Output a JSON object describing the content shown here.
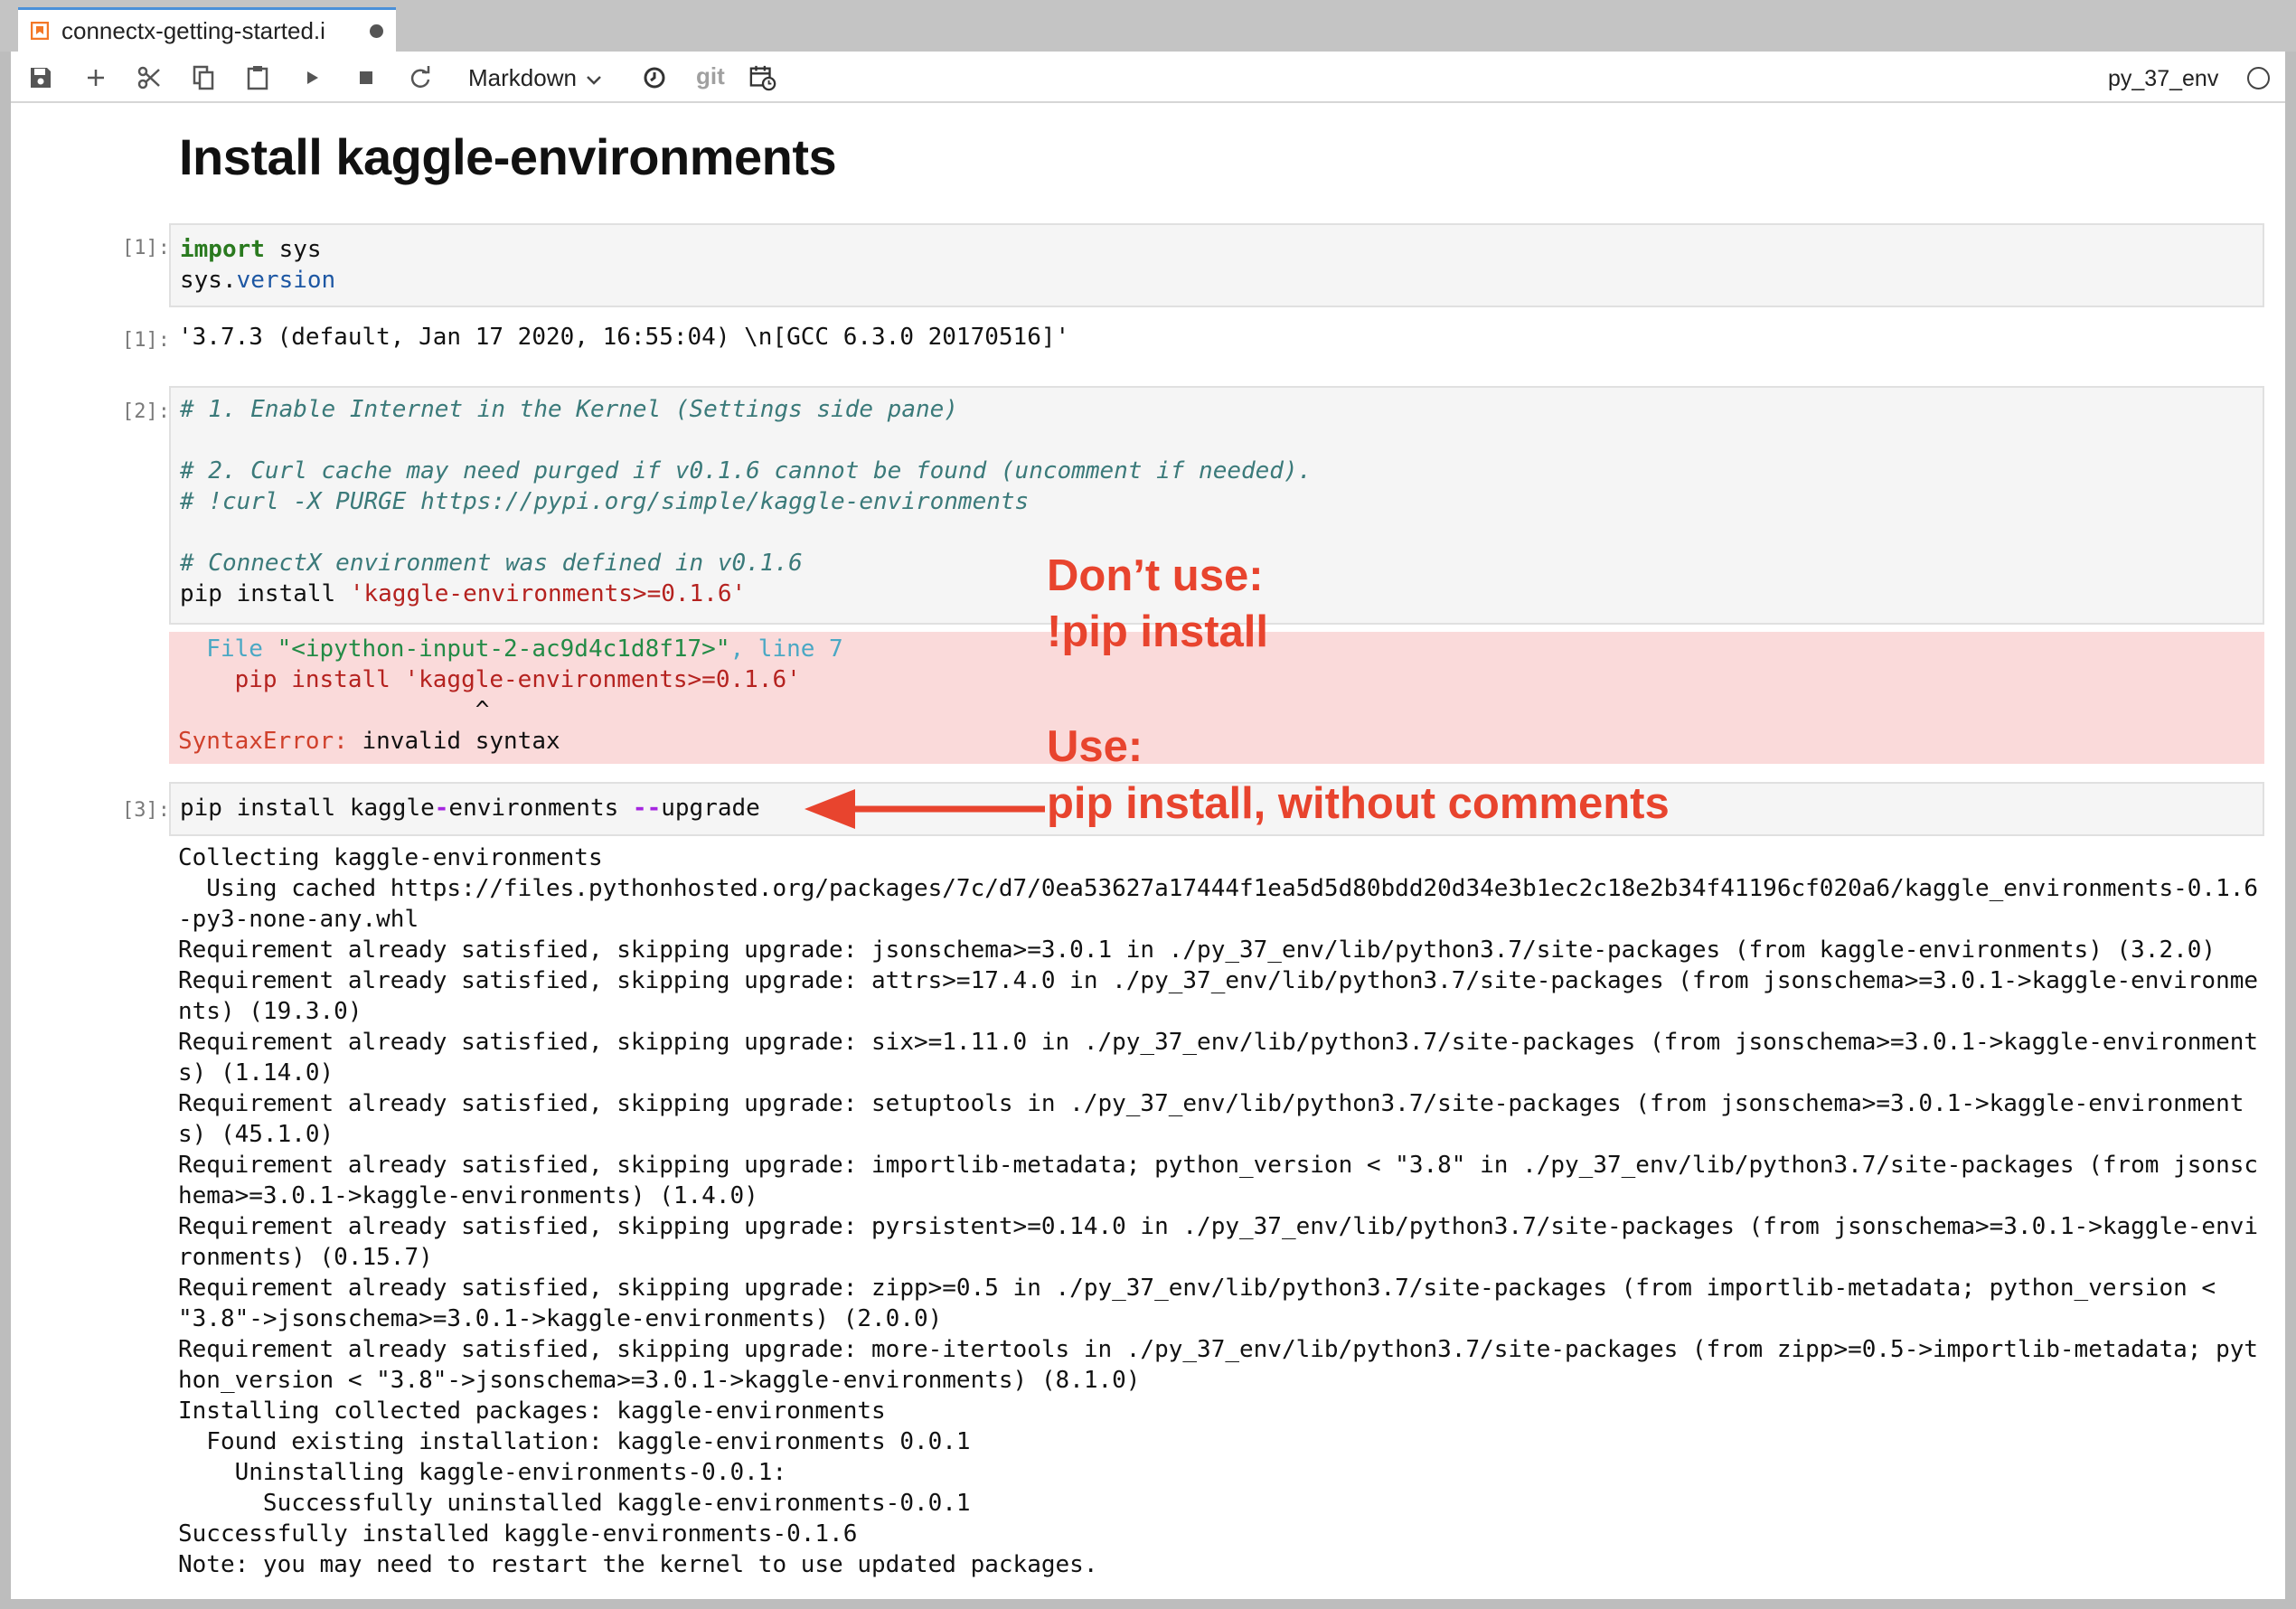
{
  "tab": {
    "title": "connectx-getting-started.i"
  },
  "toolbar": {
    "cell_type": "Markdown",
    "git": "git",
    "kernel": "py_37_env"
  },
  "heading": "Install kaggle-environments",
  "cells": {
    "c1": {
      "prompt_in": "[1]:",
      "prompt_out": "[1]:",
      "kw": "import",
      "l1rest": " sys",
      "l2a": "sys.",
      "l2b": "version",
      "output": "'3.7.3 (default, Jan 17 2020, 16:55:04) \\n[GCC 6.3.0 20170516]'"
    },
    "c2": {
      "prompt_in": "[2]:",
      "comment1": "# 1. Enable Internet in the Kernel (Settings side pane)",
      "comment2": "# 2. Curl cache may need purged if v0.1.6 cannot be found (uncomment if needed).",
      "comment3": "# !curl -X PURGE https://pypi.org/simple/kaggle-environments",
      "comment4": "# ConnectX environment was defined in v0.1.6",
      "code_plain": "pip install ",
      "code_str": "'kaggle-environments>=0.1.6'",
      "err_file_label": "  File ",
      "err_file_str": "\"<ipython-input-2-ac9d4c1d8f17>\"",
      "err_file_line": ", line 7",
      "err_code": "    pip install 'kaggle-environments>=0.1.6'",
      "err_caret": "                     ^",
      "err_name": "SyntaxError:",
      "err_msg": " invalid syntax"
    },
    "c3": {
      "prompt_in": "[3]:",
      "code_a": "pip install kaggle",
      "code_op1": "-",
      "code_b": "environments ",
      "code_op2": "--",
      "code_c": "upgrade",
      "stdout": "Collecting kaggle-environments\n  Using cached https://files.pythonhosted.org/packages/7c/d7/0ea53627a17444f1ea5d5d80bdd20d34e3b1ec2c18e2b34f41196cf020a6/kaggle_environments-0.1.6\n-py3-none-any.whl\nRequirement already satisfied, skipping upgrade: jsonschema>=3.0.1 in ./py_37_env/lib/python3.7/site-packages (from kaggle-environments) (3.2.0)\nRequirement already satisfied, skipping upgrade: attrs>=17.4.0 in ./py_37_env/lib/python3.7/site-packages (from jsonschema>=3.0.1->kaggle-environme\nnts) (19.3.0)\nRequirement already satisfied, skipping upgrade: six>=1.11.0 in ./py_37_env/lib/python3.7/site-packages (from jsonschema>=3.0.1->kaggle-environment\ns) (1.14.0)\nRequirement already satisfied, skipping upgrade: setuptools in ./py_37_env/lib/python3.7/site-packages (from jsonschema>=3.0.1->kaggle-environment\ns) (45.1.0)\nRequirement already satisfied, skipping upgrade: importlib-metadata; python_version < \"3.8\" in ./py_37_env/lib/python3.7/site-packages (from jsonsc\nhema>=3.0.1->kaggle-environments) (1.4.0)\nRequirement already satisfied, skipping upgrade: pyrsistent>=0.14.0 in ./py_37_env/lib/python3.7/site-packages (from jsonschema>=3.0.1->kaggle-envi\nronments) (0.15.7)\nRequirement already satisfied, skipping upgrade: zipp>=0.5 in ./py_37_env/lib/python3.7/site-packages (from importlib-metadata; python_version <\n\"3.8\"->jsonschema>=3.0.1->kaggle-environments) (2.0.0)\nRequirement already satisfied, skipping upgrade: more-itertools in ./py_37_env/lib/python3.7/site-packages (from zipp>=0.5->importlib-metadata; pyt\nhon_version < \"3.8\"->jsonschema>=3.0.1->kaggle-environments) (8.1.0)\nInstalling collected packages: kaggle-environments\n  Found existing installation: kaggle-environments 0.0.1\n    Uninstalling kaggle-environments-0.0.1:\n      Successfully uninstalled kaggle-environments-0.0.1\nSuccessfully installed kaggle-environments-0.1.6\nNote: you may need to restart the kernel to use updated packages."
    }
  },
  "annotations": {
    "dont_use_1": "Don’t use:",
    "dont_use_2": "!pip install",
    "use_1": "Use:",
    "use_2": "pip install, without comments"
  },
  "colors": {
    "annotation": "#e8442e",
    "error_bg": "#fadada",
    "tab_accent": "#4a90d9"
  }
}
